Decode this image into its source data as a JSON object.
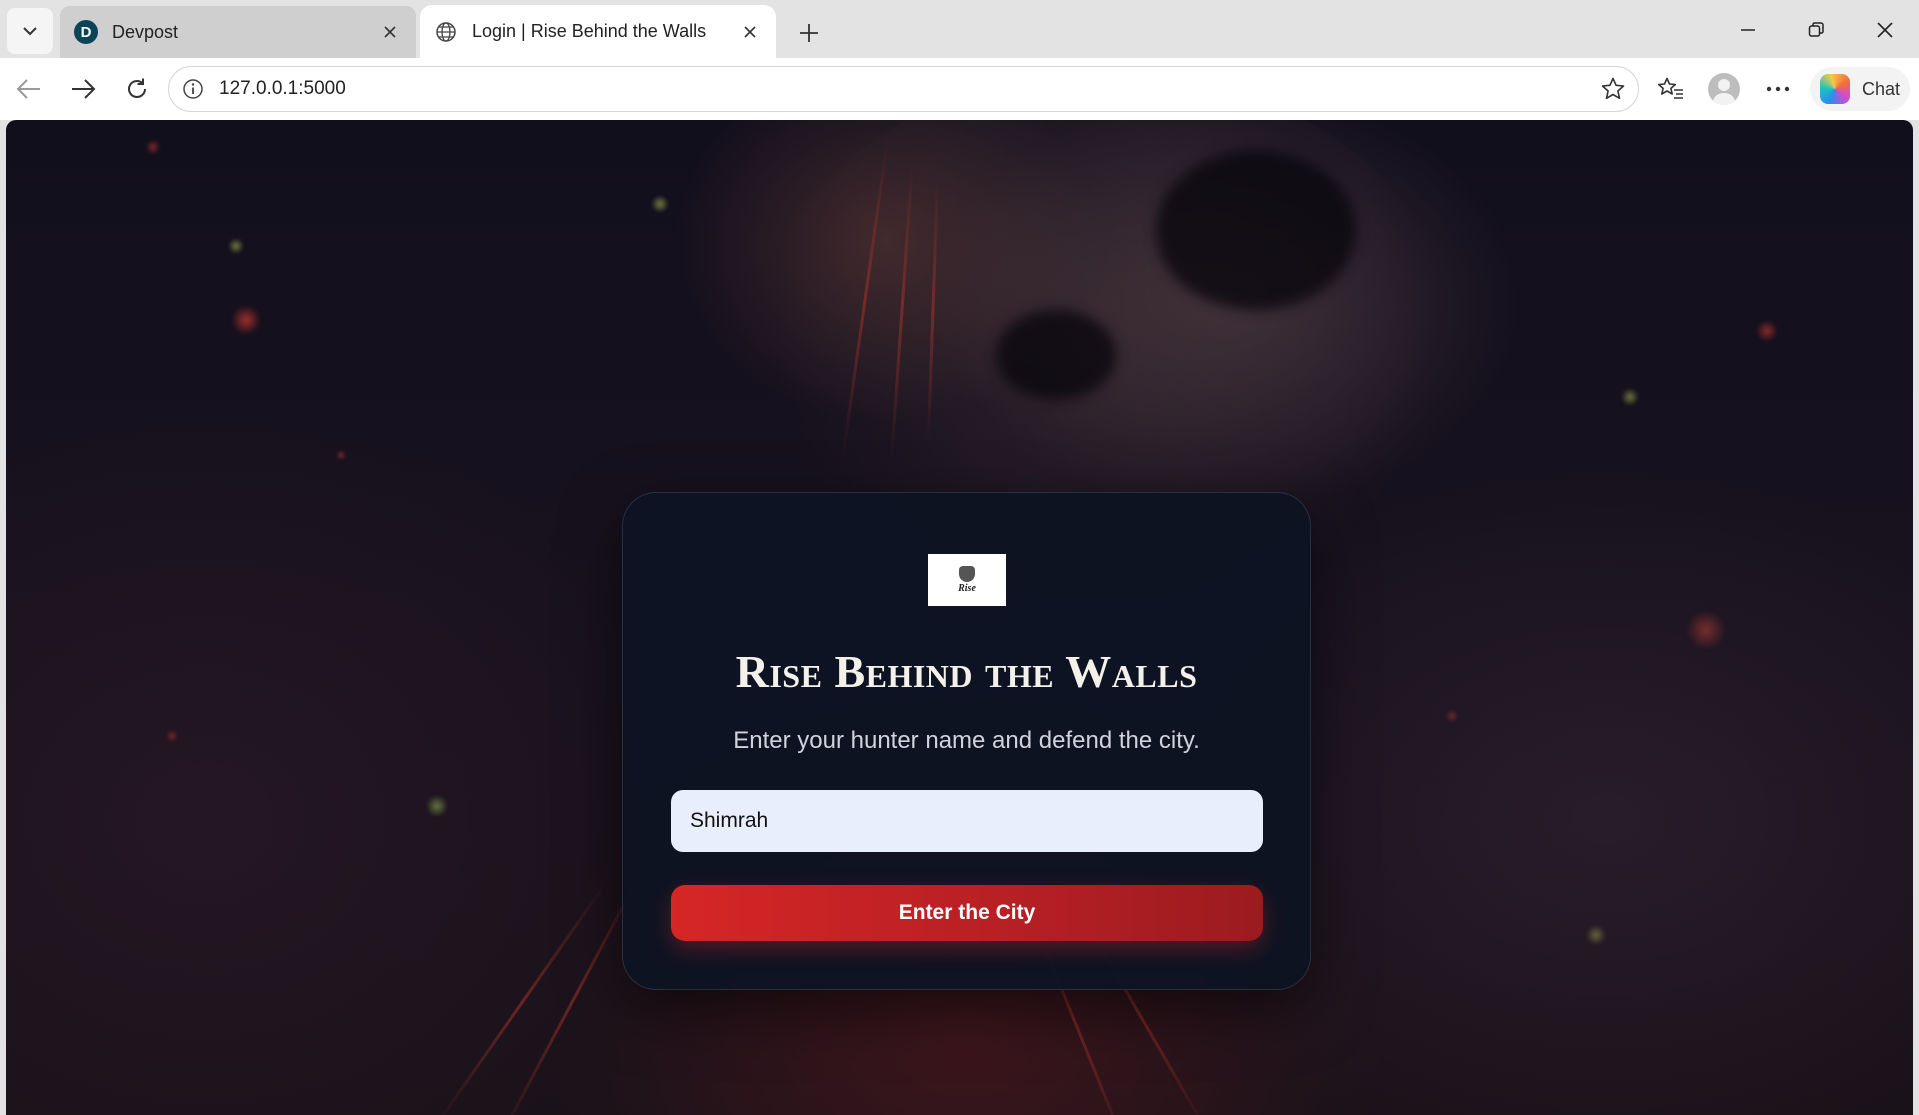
{
  "browser": {
    "tabs": [
      {
        "title": "Devpost",
        "favicon": "devpost-icon",
        "active": false
      },
      {
        "title": "Login | Rise Behind the Walls",
        "favicon": "globe-icon",
        "active": true
      }
    ],
    "address_bar": {
      "url": "127.0.0.1:5000"
    },
    "chat_label": "Chat"
  },
  "page": {
    "logo_text": "Rise",
    "title": "Rise Behind the Walls",
    "subtitle": "Enter your hunter name and defend the city.",
    "name_input": {
      "value": "Shimrah"
    },
    "enter_button_label": "Enter the City"
  },
  "colors": {
    "card_bg": "#0d1322",
    "button_red": "#d62626",
    "input_bg": "#e8eefb",
    "title_text": "#f4f1ea"
  }
}
